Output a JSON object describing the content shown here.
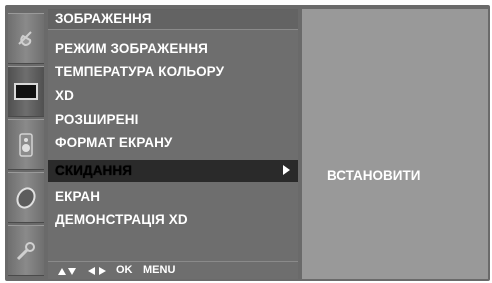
{
  "menu": {
    "title": "ЗОБРАЖЕННЯ",
    "items": [
      {
        "label": "РЕЖИМ ЗОБРАЖЕННЯ"
      },
      {
        "label": "ТЕМПЕРАТУРА КОЛЬОРУ"
      },
      {
        "label": "XD"
      },
      {
        "label": "РОЗШИРЕНІ"
      },
      {
        "label": "ФОРМАТ ЕКРАНУ"
      },
      {
        "label": "СКИДАННЯ"
      },
      {
        "label": "ЕКРАН"
      },
      {
        "label": "ДЕМОНСТРАЦІЯ XD"
      }
    ],
    "selected_index": 5
  },
  "submenu": {
    "value": "ВСТАНОВИТИ"
  },
  "footer": {
    "ok_label": "OK",
    "menu_label": "MENU"
  },
  "icons": [
    {
      "name": "satellite-dish-icon"
    },
    {
      "name": "picture-icon"
    },
    {
      "name": "speaker-icon"
    },
    {
      "name": "clock-icon"
    },
    {
      "name": "settings-key-icon"
    }
  ],
  "colors": {
    "menu_bg": "#6e6e6e",
    "submenu_bg": "#999999",
    "selected_bg": "#2a2a2a",
    "text": "#ffffff"
  }
}
